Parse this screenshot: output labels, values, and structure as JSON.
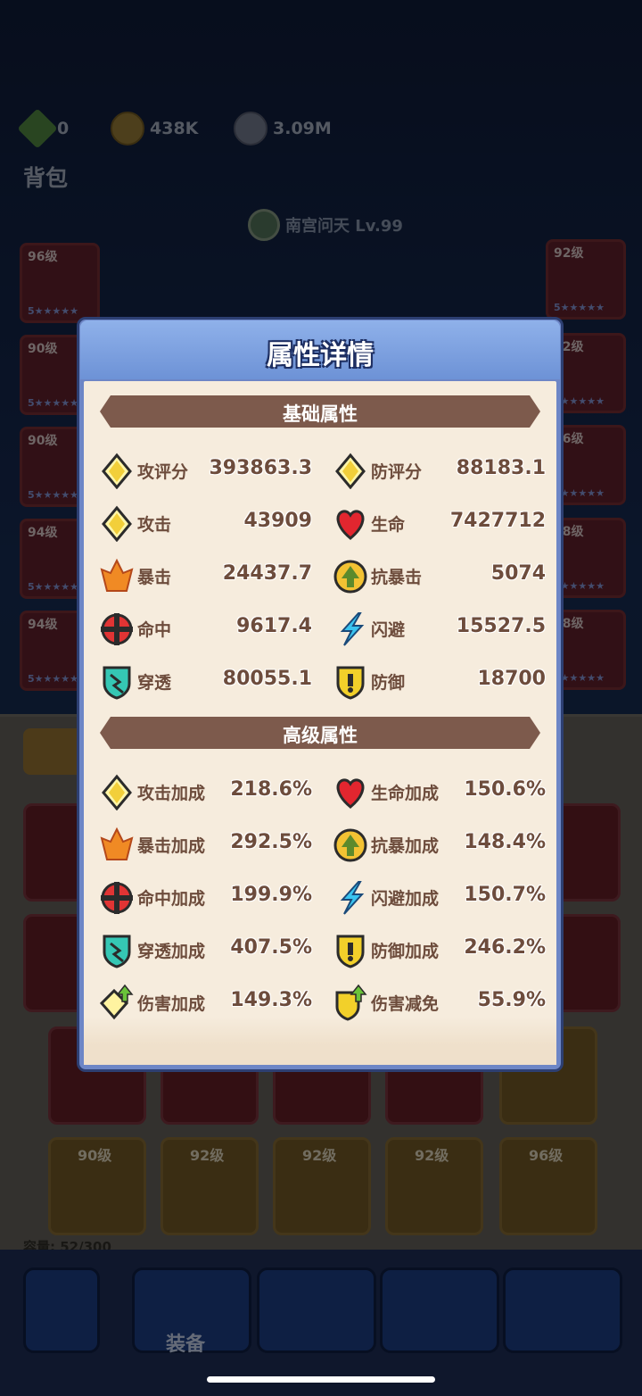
{
  "currencies": [
    {
      "icon": "green-gem-plus-icon",
      "value": "0"
    },
    {
      "icon": "gold-coin-icon",
      "value": "438K"
    },
    {
      "icon": "silver-coin-icon",
      "value": "3.09M"
    }
  ],
  "page_title": "背包",
  "hero": {
    "name": "南宫问天 Lv.99"
  },
  "left_equipment": [
    {
      "level": "96级",
      "stars": "5★★★★★"
    },
    {
      "level": "90级",
      "stars": "5★★★★★"
    },
    {
      "level": "90级",
      "stars": "5★★★★★"
    },
    {
      "level": "94级",
      "stars": "5★★★★★"
    },
    {
      "level": "94级",
      "stars": "5★★★★★"
    }
  ],
  "right_equipment": [
    {
      "level": "92级",
      "stars": "5★★★★★"
    },
    {
      "level": "92级",
      "stars": "5★★★★★"
    },
    {
      "level": "96级",
      "stars": "5★★★★★"
    },
    {
      "level": "98级",
      "stars": "3★★★★★"
    },
    {
      "level": "98级",
      "stars": "4★★★★★"
    }
  ],
  "bag_bottom_row": [
    {
      "level": "90级"
    },
    {
      "level": "92级"
    },
    {
      "level": "92级"
    },
    {
      "level": "92级"
    },
    {
      "level": "96级"
    }
  ],
  "capacity": "容量: 52/300",
  "nav": {
    "equip_label": "装备"
  },
  "dialog": {
    "title": "属性详情",
    "basic_header": "基础属性",
    "advanced_header": "高级属性",
    "basic_stats": [
      {
        "icon": "attack-rating-icon",
        "name": "攻评分",
        "value": "393863.3"
      },
      {
        "icon": "defense-rating-icon",
        "name": "防评分",
        "value": "88183.1"
      },
      {
        "icon": "attack-icon",
        "name": "攻击",
        "value": "43909"
      },
      {
        "icon": "heart-life-icon",
        "name": "生命",
        "value": "7427712"
      },
      {
        "icon": "crit-icon",
        "name": "暴击",
        "value": "24437.7"
      },
      {
        "icon": "anti-crit-icon",
        "name": "抗暴击",
        "value": "5074"
      },
      {
        "icon": "hit-icon",
        "name": "命中",
        "value": "9617.4"
      },
      {
        "icon": "dodge-icon",
        "name": "闪避",
        "value": "15527.5"
      },
      {
        "icon": "pierce-icon",
        "name": "穿透",
        "value": "80055.1"
      },
      {
        "icon": "defense-icon",
        "name": "防御",
        "value": "18700"
      }
    ],
    "advanced_stats": [
      {
        "icon": "attack-icon",
        "name": "攻击加成",
        "value": "218.6%"
      },
      {
        "icon": "heart-life-icon",
        "name": "生命加成",
        "value": "150.6%"
      },
      {
        "icon": "crit-icon",
        "name": "暴击加成",
        "value": "292.5%"
      },
      {
        "icon": "anti-crit-icon",
        "name": "抗暴加成",
        "value": "148.4%"
      },
      {
        "icon": "hit-icon",
        "name": "命中加成",
        "value": "199.9%"
      },
      {
        "icon": "dodge-icon",
        "name": "闪避加成",
        "value": "150.7%"
      },
      {
        "icon": "pierce-icon",
        "name": "穿透加成",
        "value": "407.5%"
      },
      {
        "icon": "defense-icon",
        "name": "防御加成",
        "value": "246.2%"
      },
      {
        "icon": "damage-bonus-icon",
        "name": "伤害加成",
        "value": "149.3%"
      },
      {
        "icon": "damage-reduction-icon",
        "name": "伤害减免",
        "value": "55.9%"
      }
    ]
  },
  "colors": {
    "ribbon": "#7d5a4c",
    "panel": "#f6ecdd",
    "text": "#6d4c3c",
    "frame": "#6d86c6"
  }
}
